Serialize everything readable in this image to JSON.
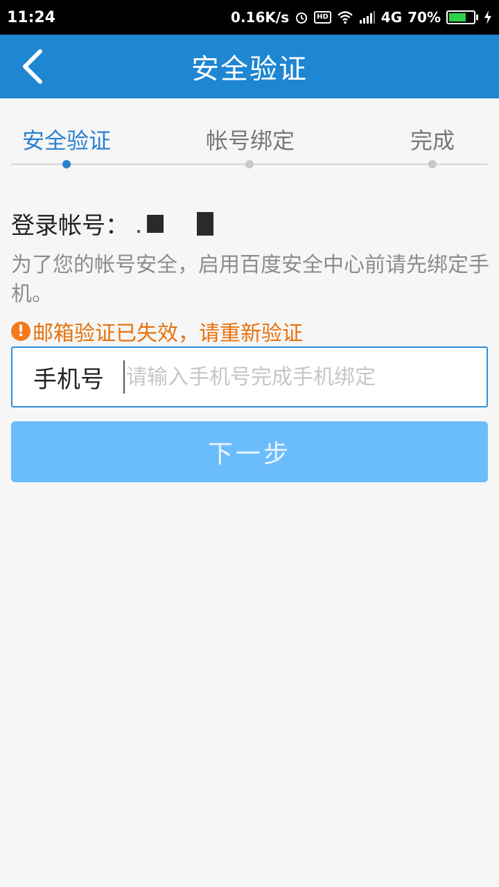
{
  "status_bar": {
    "time": "11:24",
    "network_speed": "0.16K/s",
    "hd_label": "HD",
    "network_type": "4G",
    "battery": "70%",
    "battery_level": 0.7,
    "icons": [
      "alarm-icon",
      "hd-icon",
      "wifi-icon",
      "signal-icon",
      "battery-icon",
      "charging-icon"
    ]
  },
  "nav": {
    "title": "安全验证",
    "back_icon": "chevron-left-icon"
  },
  "steps": [
    {
      "label": "安全验证",
      "active": true
    },
    {
      "label": "帐号绑定",
      "active": false
    },
    {
      "label": "完成",
      "active": false
    }
  ],
  "account": {
    "label": "登录帐号："
  },
  "description": "为了您的帐号安全，启用百度安全中心前请先绑定手机。",
  "warning": {
    "icon": "!",
    "text": "邮箱验证已失效，请重新验证"
  },
  "phone_field": {
    "label": "手机号",
    "placeholder": "请输入手机号完成手机绑定",
    "value": ""
  },
  "next_button": {
    "label": "下一步"
  },
  "colors": {
    "primary": "#1f86d2",
    "step_active": "#2b80cf",
    "warning": "#e8720c",
    "button_disabled": "#6bbcfb",
    "background": "#f6f6f6"
  }
}
